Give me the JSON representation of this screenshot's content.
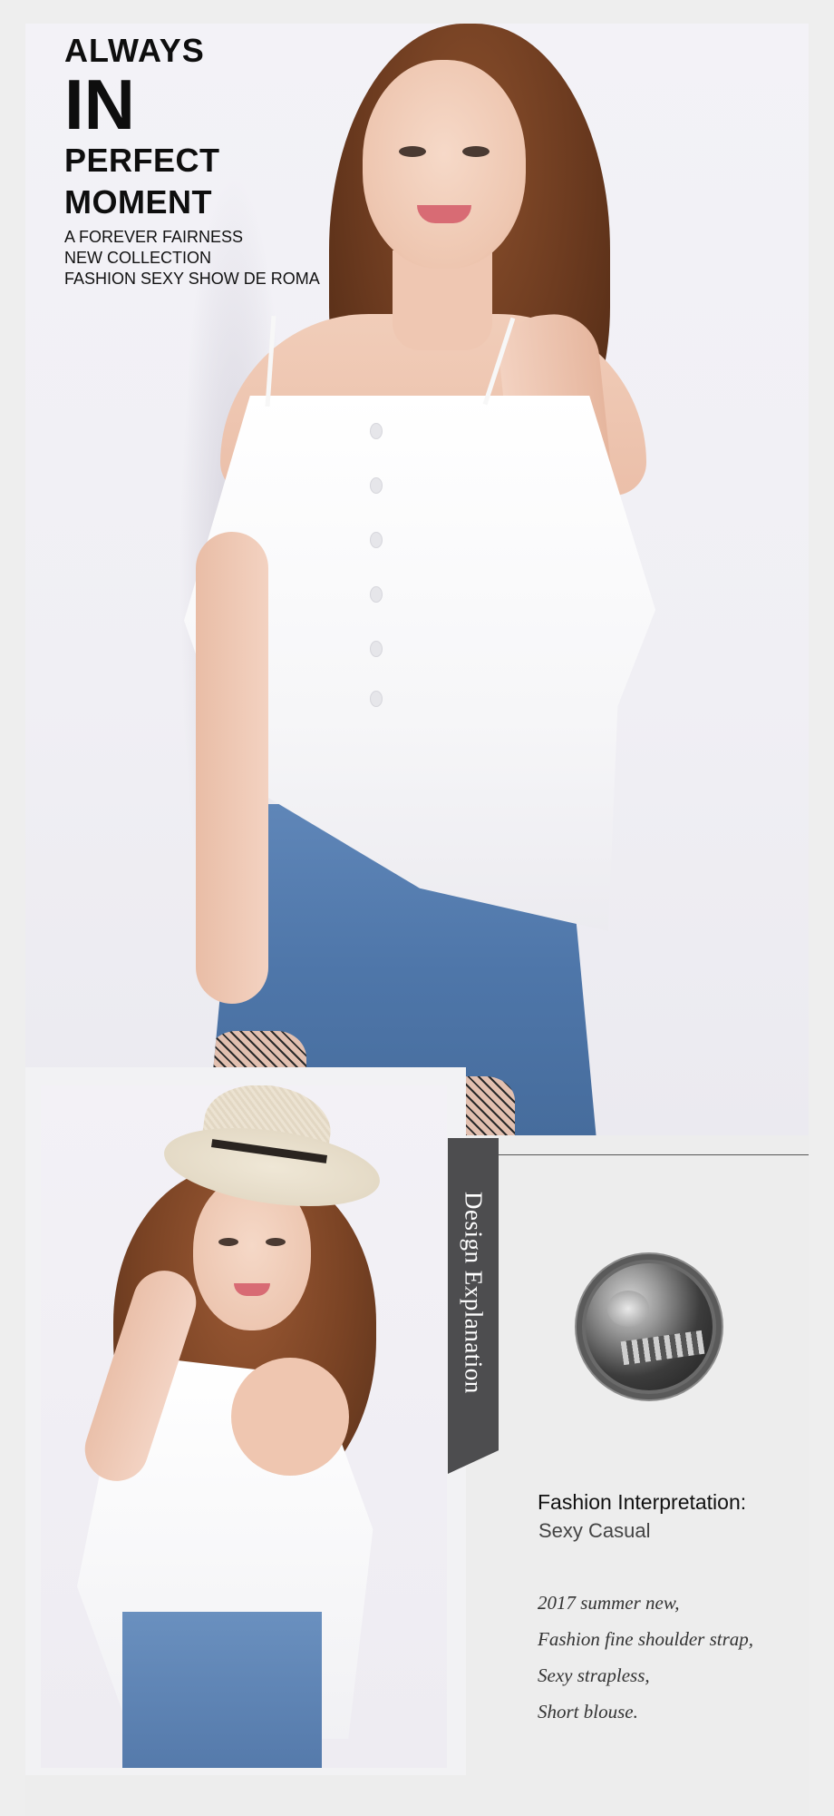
{
  "hero": {
    "headline": {
      "line1": "ALWAYS",
      "line2": "IN",
      "line3": "PERFECT",
      "line4": "MOMENT"
    },
    "subtitle": [
      "A FOREVER FAIRNESS",
      "NEW COLLECTION",
      "FASHION SEXY SHOW DE ROMA"
    ]
  },
  "design": {
    "ribbon_label": "Design Explanation",
    "interpretation_label": "Fashion Interpretation:",
    "interpretation_value": "Sexy Casual",
    "description": [
      "2017 summer new,",
      "Fashion fine shoulder strap,",
      "Sexy strapless,",
      "Short blouse."
    ]
  },
  "colors": {
    "page_background": "#eeeeee",
    "ribbon": "#4d4d4f",
    "text": "#111111"
  },
  "icons": {
    "designer_avatar": "designer-avatar-icon"
  }
}
